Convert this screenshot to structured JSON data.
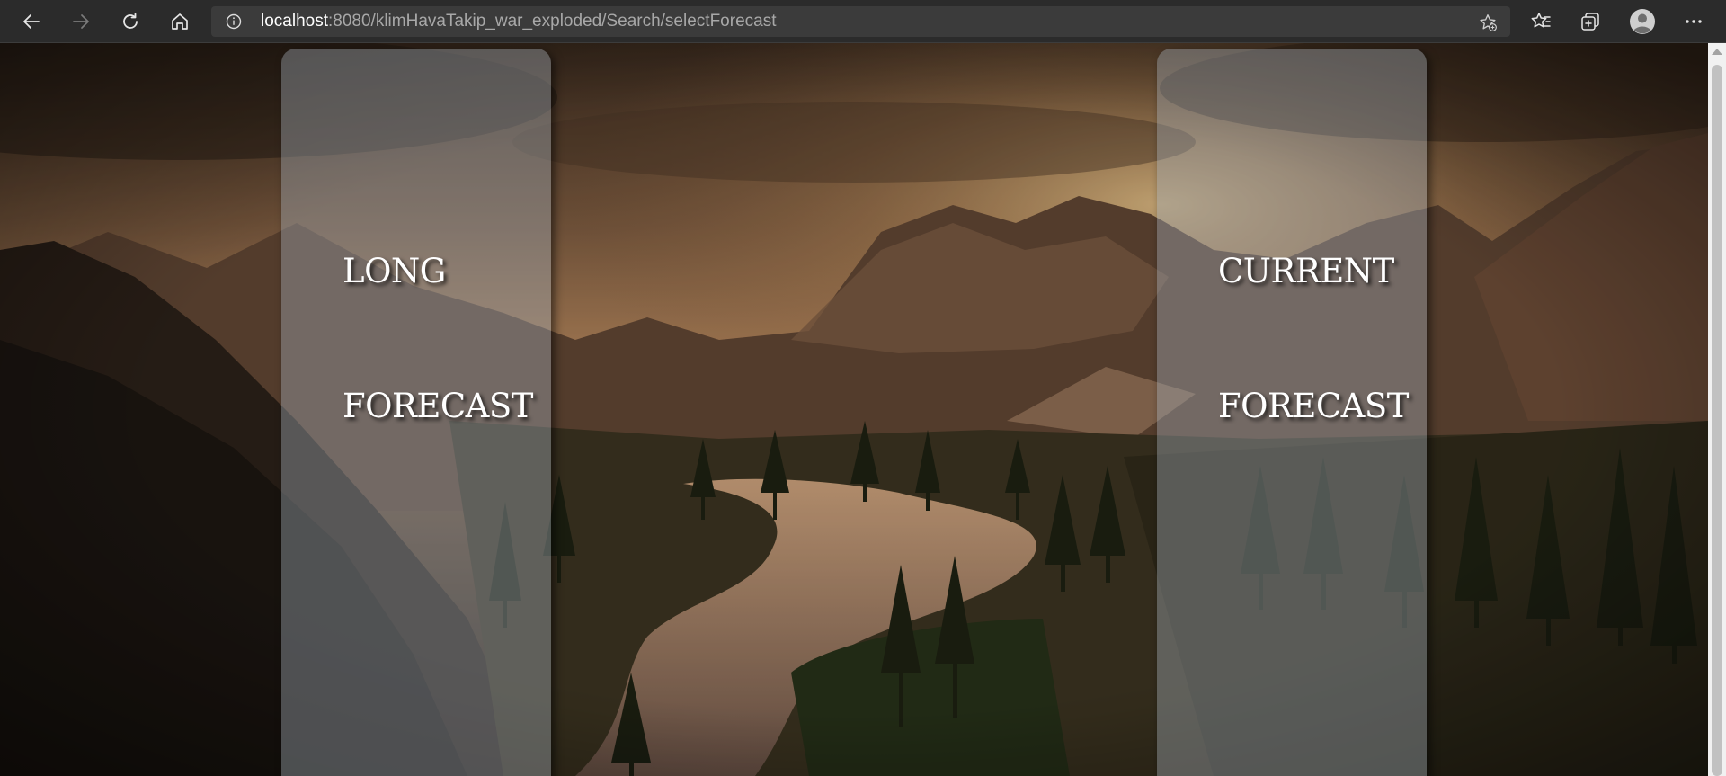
{
  "browser": {
    "url_host": "localhost",
    "url_rest": ":8080/klimHavaTakip_war_exploded/Search/selectForecast",
    "icons": [
      "back-icon",
      "forward-icon",
      "refresh-icon",
      "home-icon",
      "info-icon",
      "add-favorite-icon",
      "favorites-icon",
      "collections-icon",
      "profile-icon",
      "more-icon"
    ]
  },
  "page": {
    "panels": [
      {
        "line1": "LONG",
        "line2": "FORECAST"
      },
      {
        "line1": "CURRENT",
        "line2": "FORECAST"
      }
    ]
  },
  "colors": {
    "toolbar": "#2b2b2b",
    "address_bar": "#3b3b3b",
    "panel_tint": "#a0aab2",
    "text": "#ffffff"
  }
}
